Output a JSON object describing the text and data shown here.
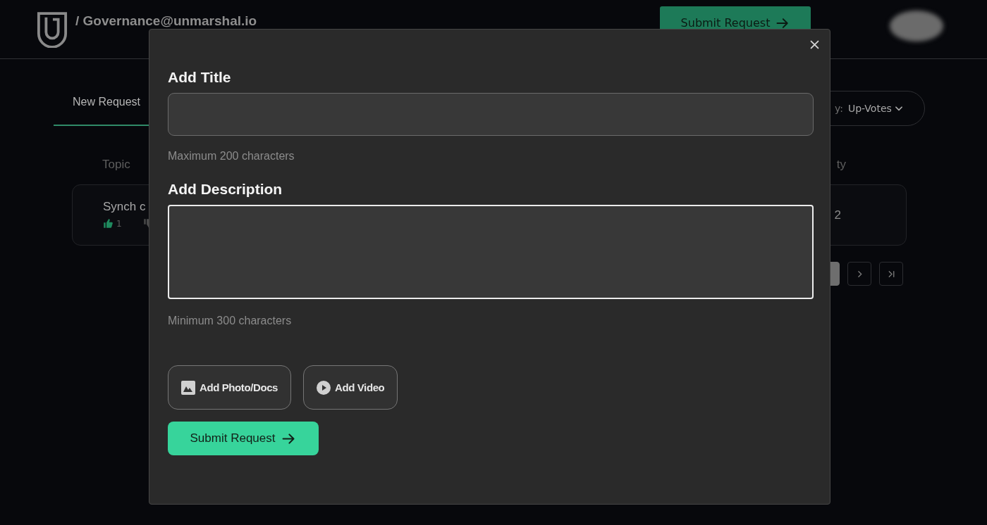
{
  "header": {
    "title": "/ Governance@unmarshal.io",
    "submit_button": "Submit Request"
  },
  "tabs": [
    {
      "label": "New Request",
      "selected": true
    }
  ],
  "sort": {
    "label": "y:",
    "value": "Up-Votes"
  },
  "table": {
    "columns": [
      "Topic",
      "ty"
    ],
    "rows": [
      {
        "topic": "Synch c",
        "upvotes": "1",
        "column_2": "2"
      }
    ]
  },
  "pagination": [
    {
      "kind": "page",
      "selected": true
    },
    {
      "kind": "next",
      "selected": false
    },
    {
      "kind": "last",
      "selected": false
    }
  ],
  "modal": {
    "fields": [
      {
        "kind": "input",
        "label": "Add Title",
        "hint": "Maximum 200 characters",
        "focused": false
      },
      {
        "kind": "textarea",
        "label": "Add Description",
        "hint": "Minimum 300 characters",
        "focused": true
      }
    ],
    "attachments": [
      {
        "kind": "photo",
        "label": "Add Photo/Docs"
      },
      {
        "kind": "video",
        "label": "Add Video"
      }
    ],
    "submit": "Submit Request"
  }
}
